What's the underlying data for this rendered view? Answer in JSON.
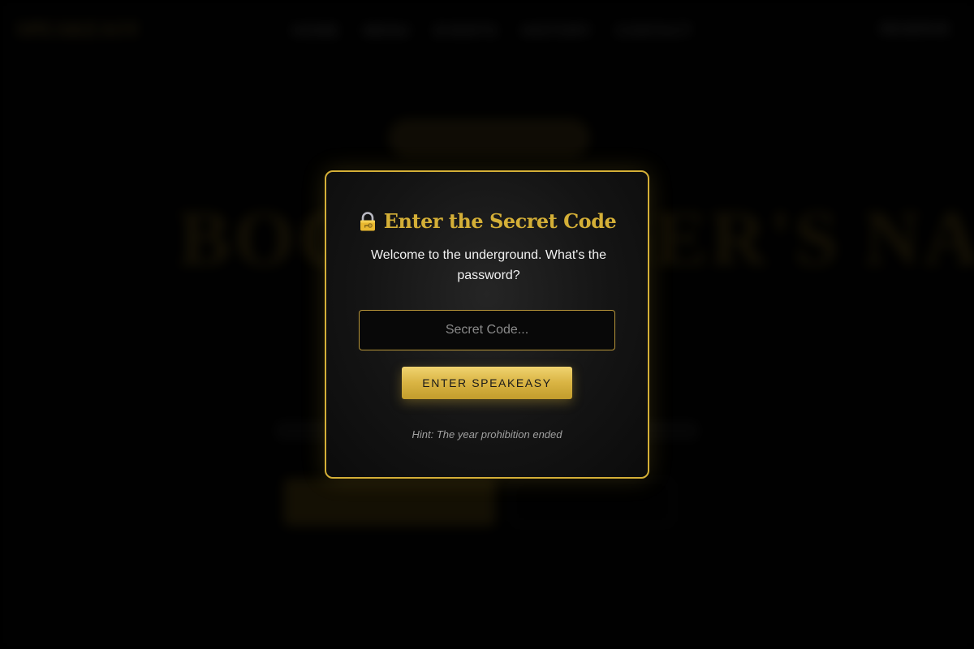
{
  "background": {
    "logo": "SPEAKEASY",
    "nav_links": [
      "HOME",
      "MENU",
      "EVENTS",
      "HISTORY",
      "CONTACT"
    ],
    "nav_cta": "RESERVE",
    "hero_title": "BOOTLEGGER'S NAME"
  },
  "modal": {
    "lock_icon": "lock-with-key-icon",
    "title": "Enter the Secret Code",
    "message": "Welcome to the underground. What's the password?",
    "input_placeholder": "Secret Code...",
    "input_value": "",
    "button_label": "ENTER SPEAKEASY",
    "hint": "Hint: The year prohibition ended"
  },
  "colors": {
    "accent_gold": "#d4af37",
    "background": "#000000"
  }
}
